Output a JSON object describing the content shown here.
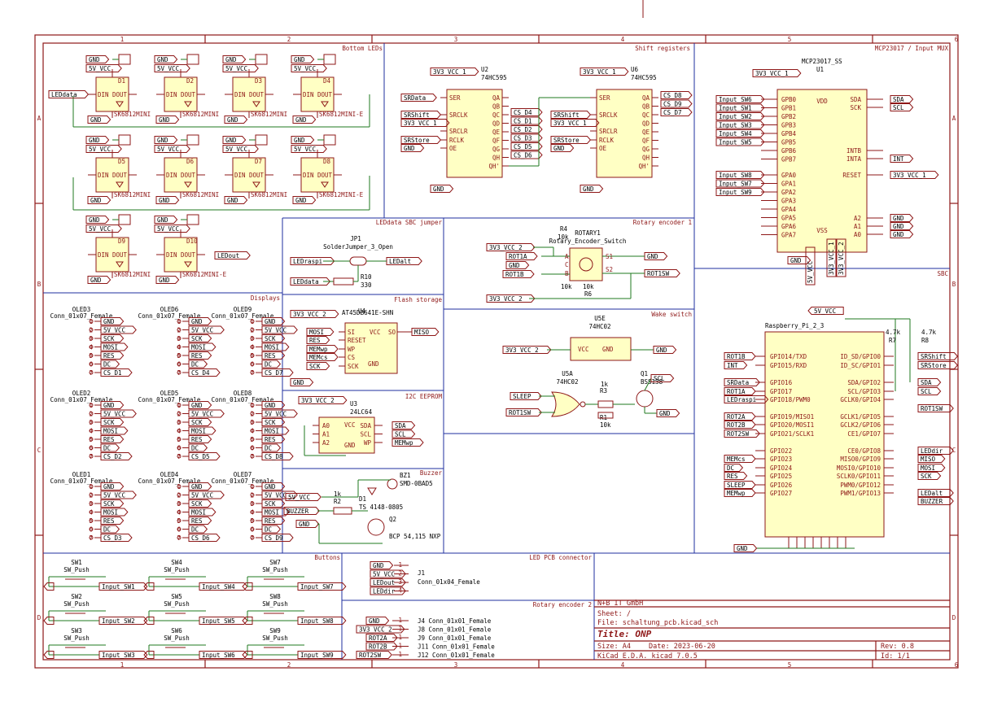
{
  "sections": [
    {
      "id": "bottom-leds",
      "label": "Bottom LEDs"
    },
    {
      "id": "shift-registers",
      "label": "Shift registers"
    },
    {
      "id": "mcp",
      "label": "MCP23017 / Input MUX"
    },
    {
      "id": "jumper",
      "label": "LEDdata SBC jumper"
    },
    {
      "id": "rotary1",
      "label": "Rotary encoder 1"
    },
    {
      "id": "displays",
      "label": "Displays"
    },
    {
      "id": "flash",
      "label": "Flash storage"
    },
    {
      "id": "wake",
      "label": "Wake switch"
    },
    {
      "id": "sbc",
      "label": "SBC"
    },
    {
      "id": "eeprom",
      "label": "I2C EEPROM"
    },
    {
      "id": "buzzer",
      "label": "Buzzer"
    },
    {
      "id": "buttons",
      "label": "Buttons"
    },
    {
      "id": "ledpcb",
      "label": "LED PCB connector"
    },
    {
      "id": "rotary2",
      "label": "Rotary encoder 2"
    }
  ],
  "grid": {
    "cols": [
      "1",
      "2",
      "3",
      "4",
      "5",
      "6"
    ],
    "rows": [
      "A",
      "B",
      "C",
      "D"
    ]
  },
  "leds": {
    "part": "SK6812MINI",
    "part_last": "SK6812MINI-E",
    "refs": [
      "D1",
      "D2",
      "D3",
      "D4",
      "D5",
      "D6",
      "D7",
      "D8",
      "D9",
      "D10"
    ],
    "pin_din": "DIN",
    "pin_dout": "DOUT",
    "pin_vdd": "VDD",
    "pin_vss": "VSS",
    "net_gnd": "GND",
    "net_5v": "5V_VCC",
    "net_in": "LEDdata",
    "net_out": "LEDout"
  },
  "shift": {
    "u2": {
      "ref": "U2",
      "part": "74HC595",
      "vcc": "3V3_VCC_1",
      "outs": [
        "CS_D4",
        "CS_D1",
        "CS_D2",
        "CS_D3",
        "CS_D5",
        "CS_D6"
      ]
    },
    "u6": {
      "ref": "U6",
      "part": "74HC595",
      "vcc": "3V3_VCC_1",
      "outs": [
        "CS_D8",
        "CS_D9",
        "CS_D7"
      ]
    },
    "pins_left": [
      "SER",
      "SRCLK",
      "SRCLR",
      "RCLK",
      "OE"
    ],
    "pins_right": [
      "QA",
      "QB",
      "QC",
      "QD",
      "QE",
      "QF",
      "QG",
      "QH",
      "QH'"
    ],
    "nets_left_u2": [
      "SRData",
      "SRShift",
      "3V3_VCC_1",
      "SRStore",
      "GND"
    ],
    "nets_left_u6": [
      "SRShift",
      "3V3_VCC_1",
      "SRStore",
      "GND"
    ],
    "gnd": "GND"
  },
  "mcp": {
    "ref": "U1",
    "part": "MCP23017_SS",
    "vcc": "3V3_VCC_1",
    "pin_vdd": "VDD",
    "pin_vss": "VSS",
    "inputs_b": [
      "Input_SW6",
      "Input_SW1",
      "Input_SW2",
      "Input_SW3",
      "Input_SW4",
      "Input_SW5"
    ],
    "pins_b": [
      "GPB0",
      "GPB1",
      "GPB2",
      "GPB3",
      "GPB4",
      "GPB5",
      "GPB6",
      "GPB7"
    ],
    "inputs_a": [
      "Input_SW8",
      "Input_SW7",
      "Input_SW9"
    ],
    "pins_a": [
      "GPA0",
      "GPA1",
      "GPA2",
      "GPA3",
      "GPA4",
      "GPA5",
      "GPA6",
      "GPA7"
    ],
    "right_pins": [
      "SDA",
      "SCK",
      "INTB",
      "INTA",
      "RESET",
      "A2",
      "A1",
      "A0"
    ],
    "right_nets": [
      "SDA",
      "SCL",
      "INT",
      "3V3_VCC_1",
      "GND",
      "GND",
      "GND"
    ],
    "gnd": "GND"
  },
  "jumper": {
    "ref": "JP1",
    "part": "SolderJumper_3_Open",
    "n1": "LEDraspi",
    "n2": "LEDalt",
    "n3": "LEDdata",
    "r_ref": "R10",
    "r_val": "330"
  },
  "rotary1": {
    "ref": "ROTARY1",
    "part": "Rotary_Encoder_Switch",
    "nets": [
      "3V3_VCC_2",
      "ROT1A",
      "GND",
      "ROT1B",
      "3V3_VCC_2"
    ],
    "r4": "R4",
    "r4v": "10k",
    "r5": "R5",
    "r5v": "10k",
    "r6": "R6",
    "r6v": "10k",
    "gnd": "GND",
    "sw": "ROT1SW",
    "pins": [
      "A",
      "C",
      "B",
      "S1",
      "S2"
    ]
  },
  "displays": {
    "part": "Conn_01x07_Female",
    "refs": [
      "OLED3",
      "OLED6",
      "OLED9",
      "OLED2",
      "OLED5",
      "OLED8",
      "OLED1",
      "OLED4",
      "OLED7"
    ],
    "nets": [
      "GND",
      "5V_VCC",
      "SCK",
      "MOSI",
      "RES",
      "DC"
    ],
    "cs": [
      "CS_D1",
      "CS_D4",
      "CS_D7",
      "CS_D2",
      "CS_D5",
      "CS_D8",
      "CS_D3",
      "CS_D6",
      "CS_D9"
    ]
  },
  "flash": {
    "ref": "U4",
    "part": "AT45DB641E-SHN",
    "vcc": "3V3_VCC_2",
    "pins": [
      "SI",
      "RESET",
      "WP",
      "CS",
      "SCK",
      "SO",
      "VCC",
      "GND"
    ],
    "nets": [
      "MOSI",
      "RES",
      "MEMwp",
      "MEMcs",
      "SCK"
    ],
    "out": "MISO",
    "gnd": "GND"
  },
  "wake": {
    "u5e": "U5E",
    "u5e_part": "74HC02",
    "u5a": "U5A",
    "u5a_part": "74HC02",
    "vcc": "3V3_VCC_2",
    "gnd": "GND",
    "sleep": "SLEEP",
    "rot": "ROT1SW",
    "r3": "R3",
    "r3v": "1k",
    "r1": "R1",
    "r1v": "10k",
    "q1": "Q1",
    "q1v": "BSS138",
    "scl": "SCL",
    "pin_vcc": "VCC",
    "pin_gnd": "GND"
  },
  "eeprom": {
    "ref": "U3",
    "part": "24LC64",
    "vcc": "3V3_VCC_2",
    "pins": [
      "A0",
      "A1",
      "A2",
      "SDA",
      "SCL",
      "WP",
      "VCC",
      "GND"
    ],
    "nets": [
      "SDA",
      "SCL",
      "MEMwp"
    ]
  },
  "buzzer": {
    "bz": "BZ1",
    "bzv": "SMD-0BAD5",
    "net5v": "5V_VCC",
    "netbz": "BUZZER",
    "netgnd": "GND",
    "r2": "R2",
    "r2v": "1k",
    "d1": "D1",
    "d1v": "TS 4148-0805",
    "q2": "Q2",
    "q2v": "BCP 54,115 NXP"
  },
  "sbc": {
    "ref": "Raspberry_Pi_2_3",
    "vcc5": "5V_VCC",
    "vcc1": "3V3_VCC_1",
    "vcc2": "3V3_VCC_2",
    "r7": "R7",
    "r7v": "4.7k",
    "r8": "R8",
    "r8v": "4.7k",
    "left_pins": [
      "GPIO14/TXD",
      "GPIO15/RXD",
      "GPIO16",
      "GPIO17",
      "GPIO18/PWM0",
      "GPIO19/MISO1",
      "GPIO20/MOSI1",
      "GPIO21/SCLK1",
      "GPIO22",
      "GPIO23",
      "GPIO24",
      "GPIO25",
      "GPIO26",
      "GPIO27"
    ],
    "left_nets": [
      "ROT1B",
      "INT",
      "SRData",
      "ROT1A",
      "LEDraspi",
      "ROT2A",
      "ROT2B",
      "ROT2SW",
      "MEMcs",
      "DC",
      "RES",
      "SLEEP",
      "MEMwp"
    ],
    "right_pins": [
      "ID_SD/GPIO0",
      "ID_SC/GPIO1",
      "SDA/GPIO2",
      "SCL/GPIO3",
      "GCLK0/GPIO4",
      "GCLK1/GPIO5",
      "GCLK2/GPIO6",
      "CE1/GPIO7",
      "CE0/GPIO8",
      "MISO0/GPIO9",
      "MOSI0/GPIO10",
      "SCLK0/GPIO11",
      "PWM0/GPIO12",
      "PWM1/GPIO13"
    ],
    "right_nets": [
      "SRShift",
      "SRStore",
      "SDA",
      "SCL",
      "ROT1SW",
      "LEDdir",
      "MISO",
      "MOSI",
      "SCK",
      "LEDalt",
      "BUZZER"
    ],
    "gnd": "GND"
  },
  "buttons": {
    "part": "SW_Push",
    "refs": [
      "SW1",
      "SW2",
      "SW3",
      "SW4",
      "SW5",
      "SW6",
      "SW7",
      "SW8",
      "SW9"
    ],
    "nets": [
      "Input_SW1",
      "Input_SW2",
      "Input_SW3",
      "Input_SW4",
      "Input_SW5",
      "Input_SW6",
      "Input_SW7",
      "Input_SW8",
      "Input_SW9"
    ]
  },
  "ledpcb": {
    "ref": "J1",
    "part": "Conn_01x04_Female",
    "nets": [
      "GND",
      "5V_VCC",
      "LEDout",
      "LEDdir"
    ]
  },
  "rotary2": {
    "nets": [
      "GND",
      "3V3_VCC_2",
      "ROT2A",
      "ROT2B",
      "ROT2SW"
    ],
    "conns": [
      "J4  Conn_01x01_Female",
      "J8  Conn_01x01_Female",
      "J9  Conn_01x01_Female",
      "J11 Conn_01x01_Female",
      "J12 Conn_01x01_Female"
    ]
  },
  "titleblock": {
    "company": "N+B IT GmbH",
    "sheet": "Sheet: /",
    "file": "File: schaltung_pcb.kicad_sch",
    "title": "Title: ONP",
    "size": "Size: A4",
    "date": "Date: 2023-06-20",
    "rev": "Rev: 0.8",
    "tool": "KiCad E.D.A.  kicad 7.0.5",
    "id": "Id: 1/1"
  }
}
